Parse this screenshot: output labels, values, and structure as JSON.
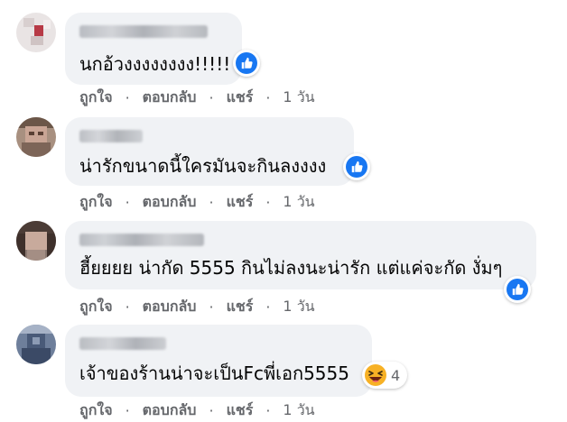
{
  "colors": {
    "bubble_bg": "#f0f2f5",
    "like_blue": "#1877f2",
    "meta_gray": "#65676b",
    "haha_yellow": "#f7b125"
  },
  "comments": [
    {
      "text": "นกอ้วงงงงงงงง!!!!!",
      "reaction": "like-icon",
      "actions": {
        "like": "ถูกใจ",
        "reply": "ตอบกลับ",
        "share": "แชร์",
        "time": "1 วัน"
      }
    },
    {
      "text": "น่ารักขนาดนี้ใครมันจะกินลงงงง",
      "reaction": "like-icon",
      "actions": {
        "like": "ถูกใจ",
        "reply": "ตอบกลับ",
        "share": "แชร์",
        "time": "1 วัน"
      }
    },
    {
      "text": "ฮี้ยยยย น่ากัด 5555 กินไม่ลงนะน่ารัก แต่แค่จะกัด งั่มๆ",
      "reaction": "like-icon",
      "actions": {
        "like": "ถูกใจ",
        "reply": "ตอบกลับ",
        "share": "แชร์",
        "time": "1 วัน"
      }
    },
    {
      "text": "เจ้าของร้านน่าจะเป็นFcพี่เอก5555",
      "reaction": "haha-icon",
      "reaction_count": "4",
      "actions": {
        "like": "ถูกใจ",
        "reply": "ตอบกลับ",
        "share": "แชร์",
        "time": "1 วัน"
      }
    }
  ]
}
